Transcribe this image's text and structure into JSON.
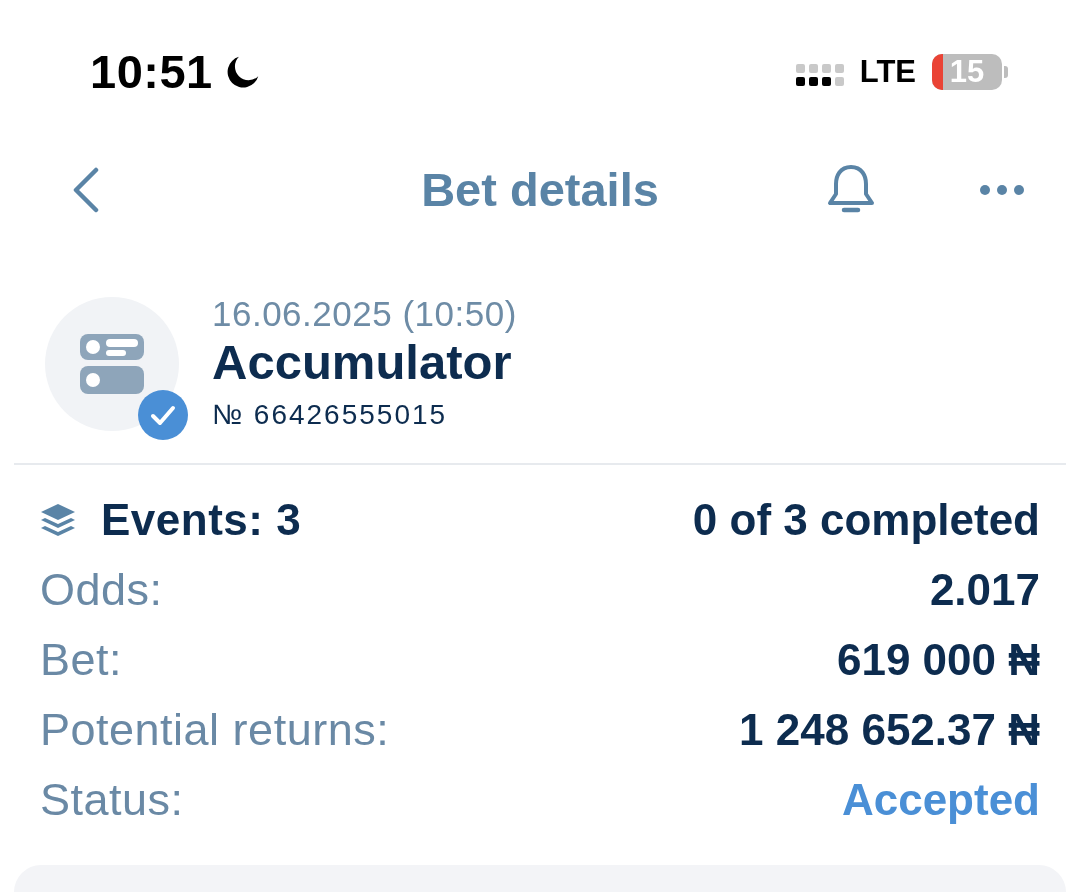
{
  "status_bar": {
    "time": "10:51",
    "network": "LTE",
    "battery": "15"
  },
  "nav": {
    "title": "Bet details"
  },
  "bet": {
    "date": "16.06.2025 (10:50)",
    "type": "Accumulator",
    "number": "№ 66426555015",
    "verified": true
  },
  "summary": {
    "rows": [
      {
        "kind": "events",
        "label": "Events: 3",
        "value": "0 of 3 completed"
      },
      {
        "kind": "plain",
        "label": "Odds:",
        "value": "2.017"
      },
      {
        "kind": "plain",
        "label": "Bet:",
        "value": "619 000 ₦"
      },
      {
        "kind": "plain",
        "label": "Potential returns:",
        "value": "1 248 652.37 ₦"
      },
      {
        "kind": "status",
        "label": "Status:",
        "value": "Accepted"
      }
    ]
  }
}
